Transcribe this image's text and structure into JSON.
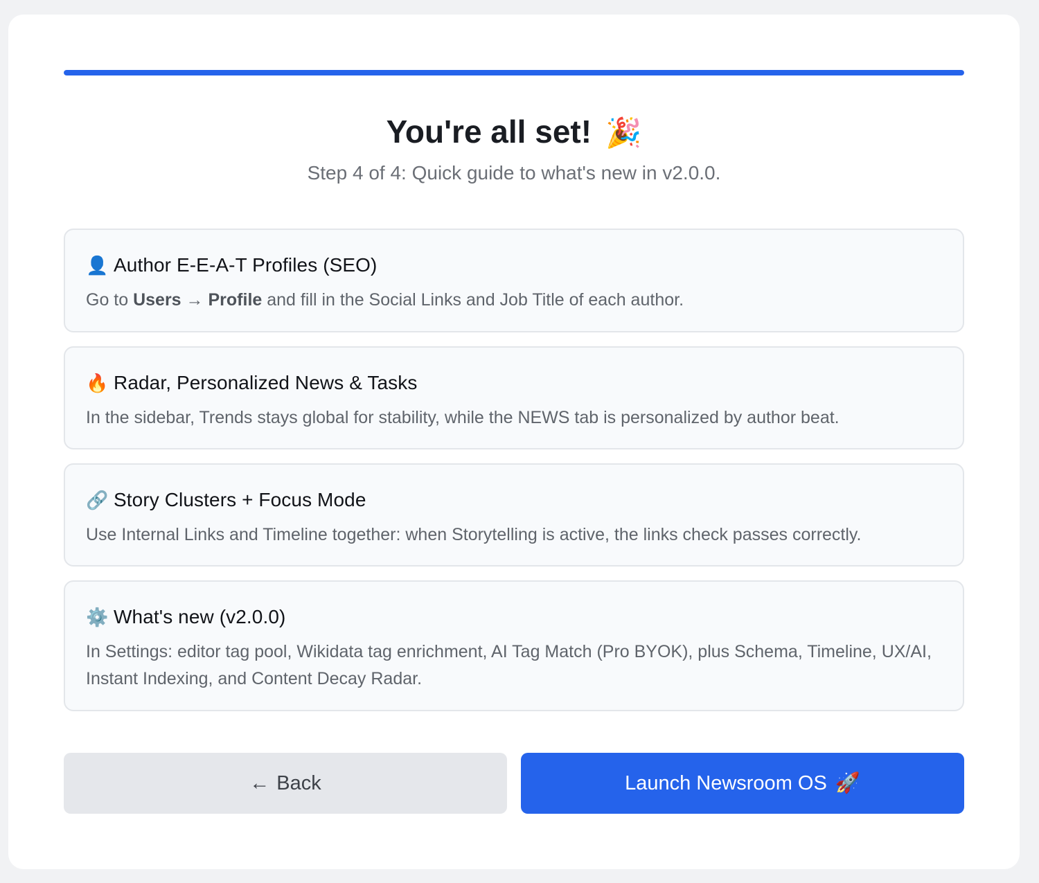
{
  "progress": {
    "fraction": 1.0,
    "color": "#2563eb"
  },
  "header": {
    "title": "You're all set!",
    "title_icon": "🎉",
    "title_icon_name": "party-popper-icon",
    "subtitle": "Step 4 of 4: Quick guide to what's new in v2.0.0."
  },
  "items": [
    {
      "icon": "👤",
      "icon_name": "user-icon",
      "title": "Author E-E-A-T Profiles (SEO)",
      "desc_pre": "Go to ",
      "desc_bold1": "Users",
      "desc_arrow": " → ",
      "desc_bold2": "Profile",
      "desc_post": " and fill in the Social Links and Job Title of each author."
    },
    {
      "icon": "🔥",
      "icon_name": "fire-icon",
      "title": "Radar, Personalized News & Tasks",
      "desc": "In the sidebar, Trends stays global for stability, while the NEWS tab is personalized by author beat."
    },
    {
      "icon": "🔗",
      "icon_name": "link-icon",
      "title": "Story Clusters + Focus Mode",
      "desc": "Use Internal Links and Timeline together: when Storytelling is active, the links check passes correctly."
    },
    {
      "icon": "⚙️",
      "icon_name": "gear-icon",
      "title": "What's new (v2.0.0)",
      "desc": "In Settings: editor tag pool, Wikidata tag enrichment, AI Tag Match (Pro BYOK), plus Schema, Timeline, UX/AI, Instant Indexing, and Content Decay Radar."
    }
  ],
  "buttons": {
    "back_arrow": "←",
    "back_label": "Back",
    "launch_label": "Launch Newsroom OS",
    "launch_icon": "🚀",
    "launch_icon_name": "rocket-icon"
  },
  "colors": {
    "accent": "#2563eb",
    "card_bg": "#f8fafc",
    "back_bg": "#e5e7eb"
  }
}
